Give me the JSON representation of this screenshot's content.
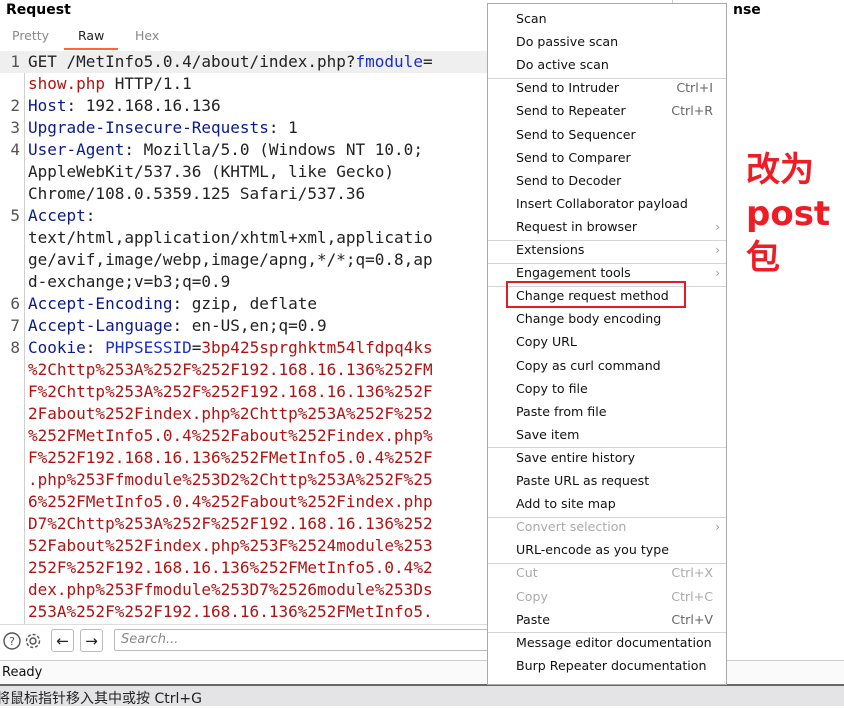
{
  "request": {
    "title": "Request",
    "tabs": [
      {
        "label": "Pretty",
        "active": false
      },
      {
        "label": "Raw",
        "active": true
      },
      {
        "label": "Hex",
        "active": false
      }
    ],
    "lines": [
      {
        "num": "1",
        "segments": [
          {
            "t": "GET /MetInfo5.0.4/about/index.php?",
            "c": "hv"
          },
          {
            "t": "fmodule",
            "c": "pm"
          },
          {
            "t": "=",
            "c": "hv"
          }
        ],
        "highlight": true
      },
      {
        "num": "",
        "segments": [
          {
            "t": "show.php",
            "c": "red"
          },
          {
            "t": " HTTP/1.1",
            "c": "hv"
          }
        ]
      },
      {
        "num": "2",
        "segments": [
          {
            "t": "Host",
            "c": "hn"
          },
          {
            "t": ": 192.168.16.136",
            "c": "hv"
          }
        ]
      },
      {
        "num": "3",
        "segments": [
          {
            "t": "Upgrade-Insecure-Requests",
            "c": "hn"
          },
          {
            "t": ": 1",
            "c": "hv"
          }
        ]
      },
      {
        "num": "4",
        "segments": [
          {
            "t": "User-Agent",
            "c": "hn"
          },
          {
            "t": ": Mozilla/5.0 (Windows NT 10.0;",
            "c": "hv"
          }
        ]
      },
      {
        "num": "",
        "segments": [
          {
            "t": "AppleWebKit/537.36 (KHTML, like Gecko)",
            "c": "hv"
          }
        ]
      },
      {
        "num": "",
        "segments": [
          {
            "t": "Chrome/108.0.5359.125 Safari/537.36",
            "c": "hv"
          }
        ]
      },
      {
        "num": "5",
        "segments": [
          {
            "t": "Accept",
            "c": "hn"
          },
          {
            "t": ":",
            "c": "hv"
          }
        ]
      },
      {
        "num": "",
        "segments": [
          {
            "t": "text/html,application/xhtml+xml,applicatio",
            "c": "hv"
          }
        ]
      },
      {
        "num": "",
        "segments": [
          {
            "t": "ge/avif,image/webp,image/apng,*/*;q=0.8,ap",
            "c": "hv"
          }
        ]
      },
      {
        "num": "",
        "segments": [
          {
            "t": "d-exchange;v=b3;q=0.9",
            "c": "hv"
          }
        ]
      },
      {
        "num": "6",
        "segments": [
          {
            "t": "Accept-Encoding",
            "c": "hn"
          },
          {
            "t": ": gzip, deflate",
            "c": "hv"
          }
        ]
      },
      {
        "num": "7",
        "segments": [
          {
            "t": "Accept-Language",
            "c": "hn"
          },
          {
            "t": ": en-US,en;q=0.9",
            "c": "hv"
          }
        ]
      },
      {
        "num": "8",
        "segments": [
          {
            "t": "Cookie",
            "c": "hn"
          },
          {
            "t": ": ",
            "c": "hv"
          },
          {
            "t": "PHPSESSID",
            "c": "pm"
          },
          {
            "t": "=",
            "c": "hv"
          },
          {
            "t": "3bp425sprghktm54lfdpq4ks",
            "c": "red"
          }
        ]
      },
      {
        "num": "",
        "segments": [
          {
            "t": "%2Chttp%253A%252F%252F192.168.16.136%252FM",
            "c": "red"
          }
        ]
      },
      {
        "num": "",
        "segments": [
          {
            "t": "F%2Chttp%253A%252F%252F192.168.16.136%252F",
            "c": "red"
          }
        ]
      },
      {
        "num": "",
        "segments": [
          {
            "t": "2Fabout%252Findex.php%2Chttp%253A%252F%252",
            "c": "red"
          }
        ]
      },
      {
        "num": "",
        "segments": [
          {
            "t": "%252FMetInfo5.0.4%252Fabout%252Findex.php%",
            "c": "red"
          }
        ]
      },
      {
        "num": "",
        "segments": [
          {
            "t": "F%252F192.168.16.136%252FMetInfo5.0.4%252F",
            "c": "red"
          }
        ]
      },
      {
        "num": "",
        "segments": [
          {
            "t": ".php%253Ffmodule%253D2%2Chttp%253A%252F%25",
            "c": "red"
          }
        ]
      },
      {
        "num": "",
        "segments": [
          {
            "t": "6%252FMetInfo5.0.4%252Fabout%252Findex.php",
            "c": "red"
          }
        ]
      },
      {
        "num": "",
        "segments": [
          {
            "t": "D7%2Chttp%253A%252F%252F192.168.16.136%252",
            "c": "red"
          }
        ]
      },
      {
        "num": "",
        "segments": [
          {
            "t": "52Fabout%252Findex.php%253F%2524module%253",
            "c": "red"
          }
        ]
      },
      {
        "num": "",
        "segments": [
          {
            "t": "252F%252F192.168.16.136%252FMetInfo5.0.4%2",
            "c": "red"
          }
        ]
      },
      {
        "num": "",
        "segments": [
          {
            "t": "dex.php%253Ffmodule%253D7%2526module%253Ds",
            "c": "red"
          }
        ]
      },
      {
        "num": "",
        "segments": [
          {
            "t": "253A%252F%252F192.168.16.136%252FMetInfo5.",
            "c": "red"
          }
        ]
      }
    ],
    "search_placeholder": "Search...",
    "icons": {
      "help": "?",
      "settings": "⚙",
      "back": "←",
      "forward": "→"
    }
  },
  "response": {
    "title_visible": "nse"
  },
  "status": {
    "text": "Ready"
  },
  "os_hint": "将鼠标指针移入其中或按 Ctrl+G",
  "annotation": {
    "lines": [
      "改为",
      "post",
      "包"
    ],
    "color": "#ee1c25"
  },
  "context_menu": {
    "items": [
      {
        "label": "Scan"
      },
      {
        "label": "Do passive scan"
      },
      {
        "label": "Do active scan",
        "sep_after": true
      },
      {
        "label": "Send to Intruder",
        "shortcut": "Ctrl+I"
      },
      {
        "label": "Send to Repeater",
        "shortcut": "Ctrl+R"
      },
      {
        "label": "Send to Sequencer"
      },
      {
        "label": "Send to Comparer"
      },
      {
        "label": "Send to Decoder"
      },
      {
        "label": "Insert Collaborator payload"
      },
      {
        "label": "Request in browser",
        "submenu": true,
        "sep_after": true
      },
      {
        "label": "Extensions",
        "submenu": true,
        "sep_after": true
      },
      {
        "label": "Engagement tools",
        "submenu": true,
        "sep_after": true
      },
      {
        "label": "Change request method",
        "highlighted_box": true
      },
      {
        "label": "Change body encoding"
      },
      {
        "label": "Copy URL"
      },
      {
        "label": "Copy as curl command"
      },
      {
        "label": "Copy to file"
      },
      {
        "label": "Paste from file"
      },
      {
        "label": "Save item",
        "sep_after": true
      },
      {
        "label": "Save entire history"
      },
      {
        "label": "Paste URL as request"
      },
      {
        "label": "Add to site map",
        "sep_after": true
      },
      {
        "label": "Convert selection",
        "submenu": true,
        "disabled": true
      },
      {
        "label": "URL-encode as you type",
        "sep_after": true
      },
      {
        "label": "Cut",
        "shortcut": "Ctrl+X",
        "disabled": true
      },
      {
        "label": "Copy",
        "shortcut": "Ctrl+C",
        "disabled": true
      },
      {
        "label": "Paste",
        "shortcut": "Ctrl+V",
        "sep_after": true
      },
      {
        "label": "Message editor documentation"
      },
      {
        "label": "Burp Repeater documentation"
      }
    ],
    "highlight_color": "#e02020"
  }
}
